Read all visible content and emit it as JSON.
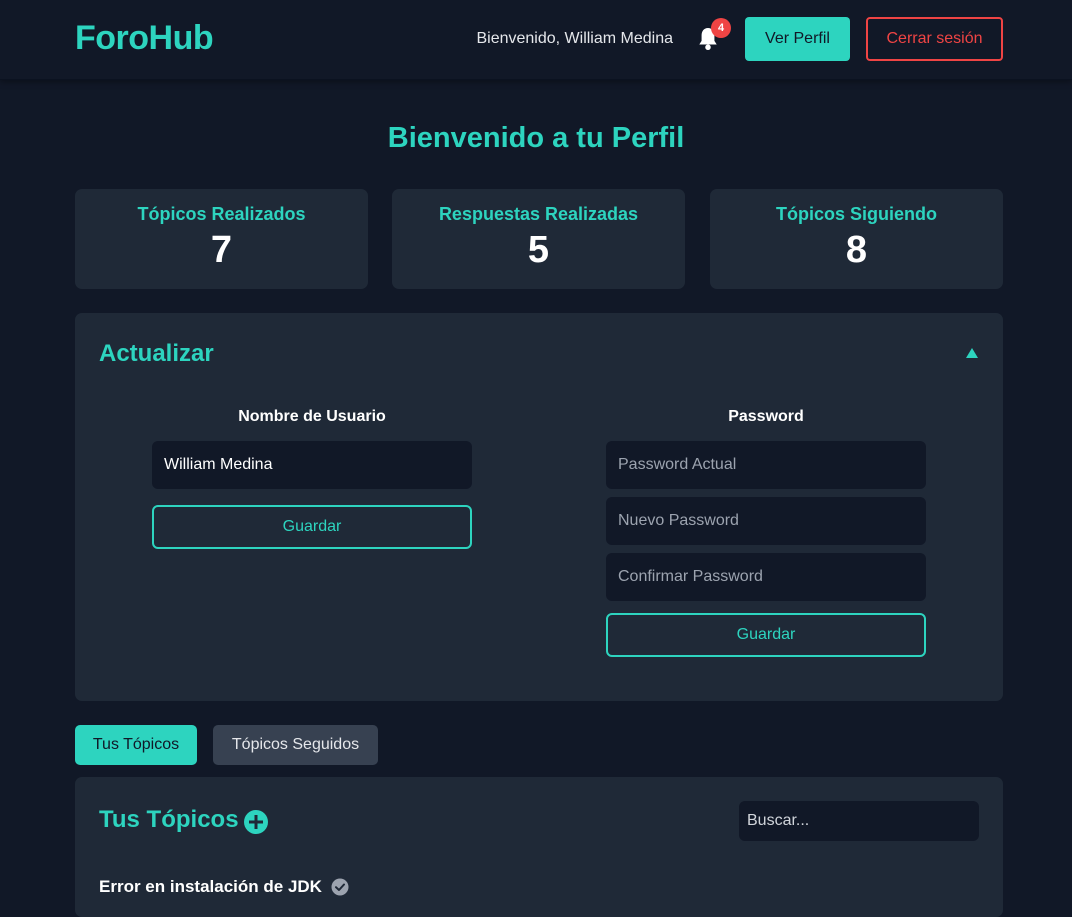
{
  "header": {
    "brand": "ForoHub",
    "welcome": "Bienvenido, William Medina",
    "notification_count": "4",
    "profile_button": "Ver Perfil",
    "logout_button": "Cerrar sesión"
  },
  "page": {
    "title": "Bienvenido a tu Perfil"
  },
  "stats": [
    {
      "label": "Tópicos Realizados",
      "value": "7"
    },
    {
      "label": "Respuestas Realizadas",
      "value": "5"
    },
    {
      "label": "Tópicos Siguiendo",
      "value": "8"
    }
  ],
  "update": {
    "title": "Actualizar",
    "username": {
      "label": "Nombre de Usuario",
      "value": "William Medina",
      "save": "Guardar"
    },
    "password": {
      "label": "Password",
      "current_placeholder": "Password Actual",
      "new_placeholder": "Nuevo Password",
      "confirm_placeholder": "Confirmar Password",
      "save": "Guardar"
    }
  },
  "tabs": [
    {
      "label": "Tus Tópicos",
      "active": true
    },
    {
      "label": "Tópicos Seguidos",
      "active": false
    }
  ],
  "topics": {
    "title": "Tus Tópicos",
    "search_placeholder": "Buscar...",
    "items": [
      {
        "title": "Error en instalación de JDK",
        "icon": "check-circle-icon"
      }
    ]
  },
  "colors": {
    "accent": "#2dd4bf",
    "danger": "#ef4444",
    "background": "#111827",
    "card": "#1f2937"
  }
}
